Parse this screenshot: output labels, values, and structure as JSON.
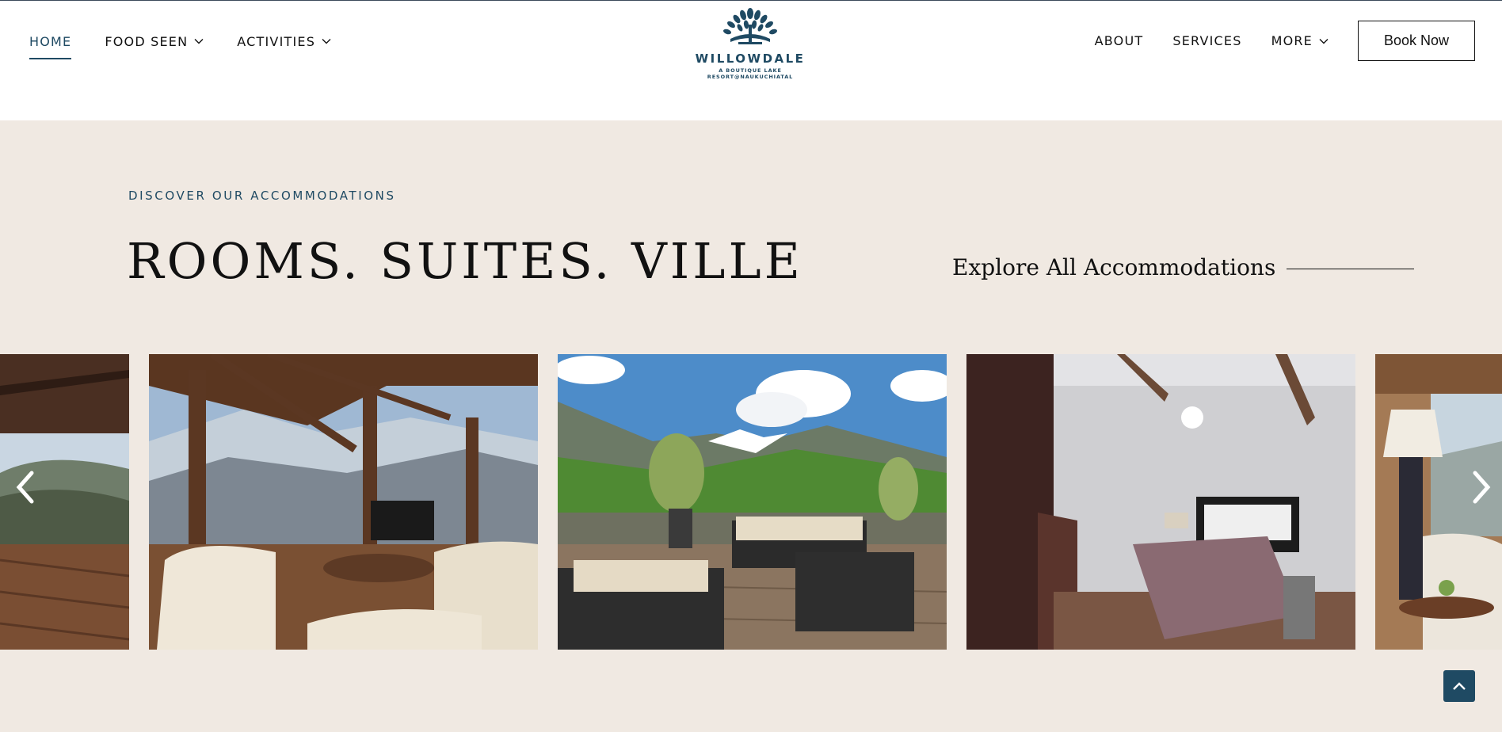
{
  "header": {
    "nav_left": [
      {
        "label": "HOME",
        "active": true,
        "dropdown": false
      },
      {
        "label": "FOOD SEEN",
        "active": false,
        "dropdown": true
      },
      {
        "label": "ACTIVITIES",
        "active": false,
        "dropdown": true
      }
    ],
    "nav_right": [
      {
        "label": "ABOUT",
        "dropdown": false
      },
      {
        "label": "SERVICES",
        "dropdown": false
      },
      {
        "label": "MORE",
        "dropdown": true
      }
    ],
    "book_button": "Book Now",
    "logo": {
      "name": "WILLOWDALE",
      "tagline": "A BOUTIQUE LAKE RESORT@NAUKUCHIATAL",
      "icon": "willow-tree-icon"
    }
  },
  "section": {
    "eyebrow": "DISCOVER OUR ACCOMMODATIONS",
    "title": "ROOMS. SUITES. VILLE",
    "explore_link": "Explore All Accommodations"
  },
  "carousel": {
    "slides": [
      {
        "name": "balcony-mountain-view-photo"
      },
      {
        "name": "chalet-living-room-photo"
      },
      {
        "name": "mountain-terrace-lounge-photo"
      },
      {
        "name": "bedroom-photo"
      },
      {
        "name": "lamp-room-view-photo"
      }
    ],
    "prev_icon": "chevron-left-icon",
    "next_icon": "chevron-right-icon"
  },
  "scroll_top": {
    "icon": "chevron-up-icon"
  },
  "colors": {
    "accent": "#1f4a63",
    "section_bg": "#f0e9e2",
    "header_bg": "#ffffff"
  }
}
